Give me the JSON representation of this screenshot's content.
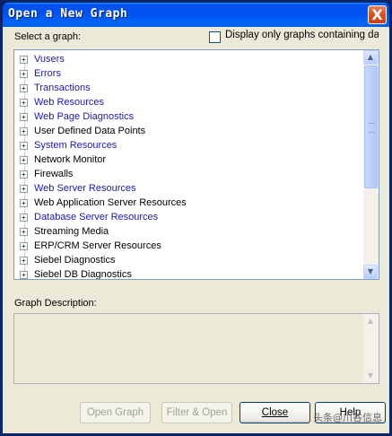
{
  "window": {
    "title": "Open a New Graph",
    "close_glyph": "X"
  },
  "select_label": "Select a graph:",
  "filter_checkbox": {
    "label": "Display only graphs containing data",
    "checked": false
  },
  "tree": {
    "expander_glyph": "+",
    "items": [
      {
        "label": "Vusers",
        "color": "#1a1aa8"
      },
      {
        "label": "Errors",
        "color": "#1a1aa8"
      },
      {
        "label": "Transactions",
        "color": "#1a1aa8"
      },
      {
        "label": "Web Resources",
        "color": "#1a1aa8"
      },
      {
        "label": "Web Page Diagnostics",
        "color": "#1a1aa8"
      },
      {
        "label": "User Defined Data Points",
        "color": "#000000"
      },
      {
        "label": "System Resources",
        "color": "#1a1aa8"
      },
      {
        "label": "Network Monitor",
        "color": "#000000"
      },
      {
        "label": "Firewalls",
        "color": "#000000"
      },
      {
        "label": "Web Server Resources",
        "color": "#1a1aa8"
      },
      {
        "label": "Web Application Server Resources",
        "color": "#000000"
      },
      {
        "label": "Database Server Resources",
        "color": "#1a1aa8"
      },
      {
        "label": "Streaming Media",
        "color": "#000000"
      },
      {
        "label": "ERP/CRM Server Resources",
        "color": "#000000"
      },
      {
        "label": "Siebel Diagnostics",
        "color": "#000000"
      },
      {
        "label": "Siebel DB Diagnostics",
        "color": "#000000"
      }
    ],
    "scroll_up_glyph": "▲",
    "scroll_down_glyph": "▼"
  },
  "description_label": "Graph Description:",
  "buttons": {
    "open_graph": "Open Graph",
    "filter_open": "Filter & Open",
    "close": "Close",
    "help": "Help"
  },
  "watermark": "头条@川谷信息"
}
